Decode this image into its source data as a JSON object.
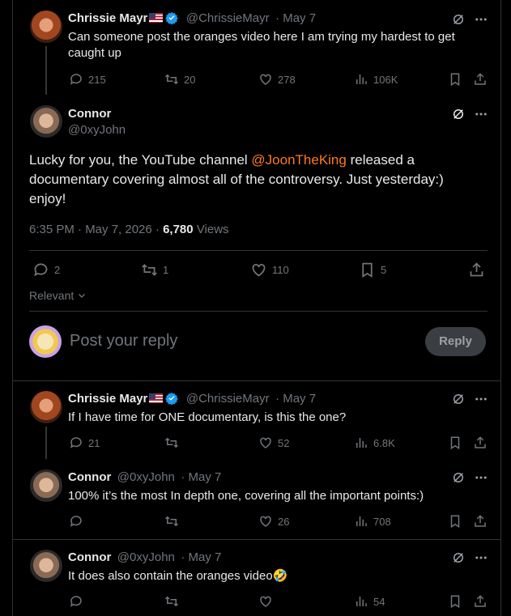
{
  "tweets": [
    {
      "name": "Chrissie Mayr",
      "handle": "@ChrissieMayr",
      "date": "· May 7",
      "text": "Can someone post the oranges video here I am trying my hardest to get caught up",
      "replies": "215",
      "retweets": "20",
      "likes": "278",
      "views": "106K"
    },
    {
      "name": "Connor",
      "handle": "@0xyJohn",
      "text_before": "Lucky for you, the YouTube channel ",
      "mention": "@JoonTheKing",
      "text_after": " released a documentary covering almost all of the controversy. Just yesterday:) enjoy!",
      "timestamp": "6:35 PM · May 7, 2026 · ",
      "views_count": "6,780",
      "views_label": " Views",
      "replies": "2",
      "retweets": "1",
      "likes": "110",
      "bookmarks": "5"
    }
  ],
  "sort_label": "Relevant",
  "composer": {
    "placeholder": "Post your reply",
    "button": "Reply"
  },
  "replies": [
    {
      "name": "Chrissie Mayr",
      "handle": "@ChrissieMayr",
      "date": "· May 7",
      "text": "If I have time for ONE documentary, is this the one?",
      "replies": "21",
      "retweets": "",
      "likes": "52",
      "views": "6.8K"
    },
    {
      "name": "Connor",
      "handle": "@0xyJohn",
      "date": "· May 7",
      "text": "100% it’s the most In depth one, covering all the important points:)",
      "replies": "",
      "retweets": "",
      "likes": "26",
      "views": "708"
    },
    {
      "name": "Connor",
      "handle": "@0xyJohn",
      "date": "· May 7",
      "text": "It does also contain the oranges video",
      "emoji": "🤣",
      "replies": "",
      "retweets": "",
      "likes": "",
      "views": "54"
    }
  ],
  "colors": {
    "background": "#000000",
    "text": "#e7e9ea",
    "muted": "#71767b",
    "mention": "#ff7a1a",
    "verified": "#1d9bf0"
  }
}
